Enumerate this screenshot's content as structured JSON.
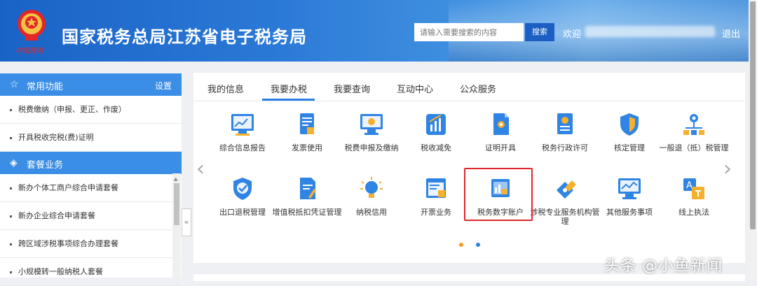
{
  "header": {
    "app_title": "国家税务总局江苏省电子税务局",
    "emblem_caption": "中国税务",
    "search_placeholder": "请输入需要搜索的内容",
    "search_button": "搜索",
    "welcome": "欢迎",
    "logout": "退出",
    "accent": "#2a78d6"
  },
  "sidebar": {
    "common_title": "常用功能",
    "settings": "设置",
    "common_items": [
      {
        "label": "税费缴纳（申报、更正、作废）"
      },
      {
        "label": "开具税收完税(费)证明"
      }
    ],
    "package_title": "套餐业务",
    "package_items": [
      {
        "label": "新办个体工商户综合申请套餐"
      },
      {
        "label": "新办企业综合申请套餐"
      },
      {
        "label": "跨区域涉税事项综合办理套餐"
      },
      {
        "label": "小规模转一般纳税人套餐"
      }
    ],
    "collapse_glyph": "«"
  },
  "main": {
    "tabs": [
      {
        "label": "我的信息"
      },
      {
        "label": "我要办税",
        "active": true
      },
      {
        "label": "我要查询"
      },
      {
        "label": "互动中心"
      },
      {
        "label": "公众服务"
      }
    ],
    "row1": [
      {
        "label": "综合信息报告",
        "icon": "report-chart-icon"
      },
      {
        "label": "发票使用",
        "icon": "invoice-document-icon"
      },
      {
        "label": "税费申报及缴纳",
        "icon": "monitor-declare-icon"
      },
      {
        "label": "税收减免",
        "icon": "tax-relief-icon"
      },
      {
        "label": "证明开具",
        "icon": "certificate-icon"
      },
      {
        "label": "税务行政许可",
        "icon": "license-badge-icon"
      },
      {
        "label": "核定管理",
        "icon": "shield-icon"
      },
      {
        "label": "一般退（抵）税管理",
        "icon": "location-network-icon"
      }
    ],
    "row2": [
      {
        "label": "出口退税管理",
        "icon": "shield-check-icon"
      },
      {
        "label": "增值税抵扣凭证管理",
        "icon": "document-edit-icon"
      },
      {
        "label": "纳税信用",
        "icon": "credit-bulb-icon"
      },
      {
        "label": "开票业务",
        "icon": "invoicing-window-icon"
      },
      {
        "label": "税务数字账户",
        "icon": "digital-account-icon",
        "highlighted": true
      },
      {
        "label": "涉税专业服务机构管理",
        "icon": "agency-tag-icon"
      },
      {
        "label": "其他服务事项",
        "icon": "monitor-wave-icon"
      },
      {
        "label": "线上执法",
        "icon": "translate-law-icon"
      }
    ],
    "prev_glyph": "‹",
    "next_glyph": "›"
  },
  "watermark": "头条 @小鱼新闻"
}
